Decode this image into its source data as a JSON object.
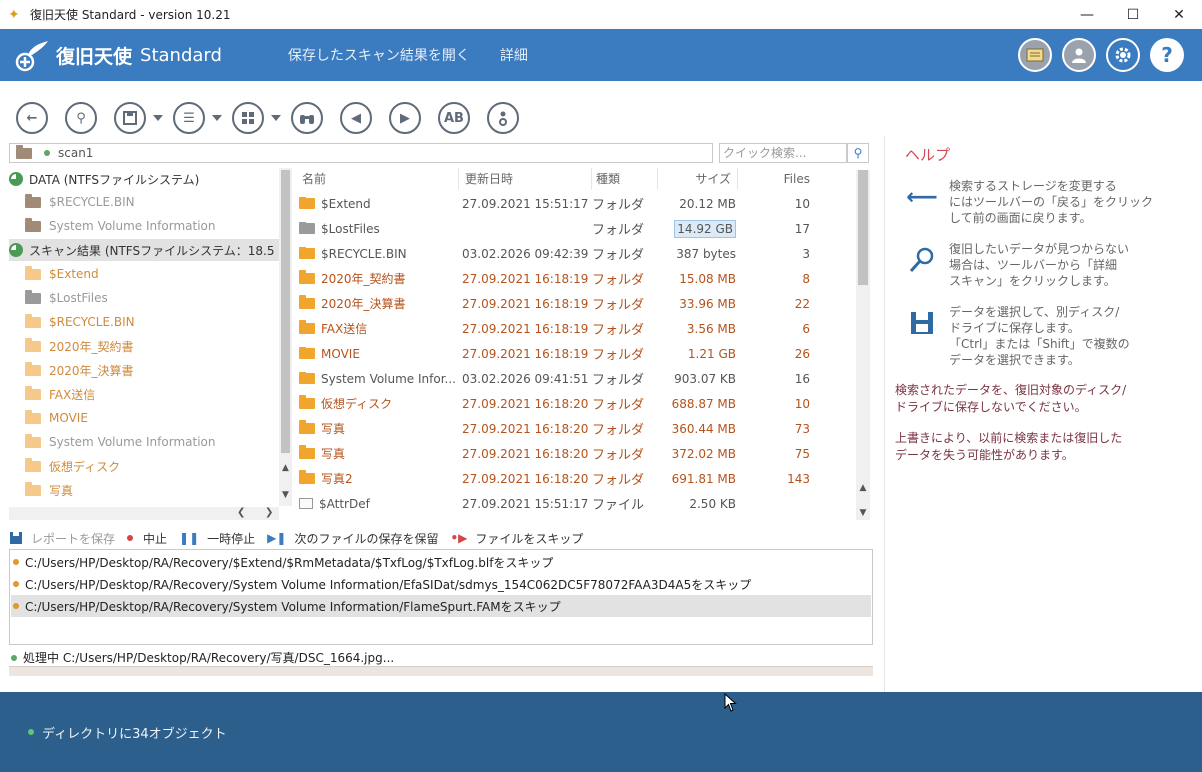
{
  "window": {
    "title": "復旧天使 Standard - version 10.21",
    "controls": [
      "minimize",
      "maximize",
      "close"
    ]
  },
  "header": {
    "brand": "復旧天使",
    "brand_sub": "Standard",
    "links": [
      "保存したスキャン結果を開く",
      "詳細"
    ],
    "icons": [
      "news-icon",
      "user-icon",
      "settings-icon",
      "help-icon"
    ]
  },
  "toolbar": {
    "buttons": [
      "back-icon",
      "search-icon",
      "save-icon",
      "list-icon",
      "view-icon",
      "find-icon",
      "prev-icon",
      "next-icon",
      "case-icon",
      "info-icon"
    ],
    "case_label": "AB"
  },
  "pathbar": {
    "text": "scan1"
  },
  "search": {
    "placeholder": "クイック検索..."
  },
  "tree": {
    "root1": "DATA (NTFSファイルシステム)",
    "root1_items": [
      "$RECYCLE.BIN",
      "System Volume Information"
    ],
    "root2": "スキャン結果 (NTFSファイルシステム：18.5",
    "root2_items": [
      "$Extend",
      "$LostFiles",
      "$RECYCLE.BIN",
      "2020年_契約書",
      "2020年_決算書",
      "FAX送信",
      "MOVIE",
      "System Volume Information",
      "仮想ディスク",
      "写真"
    ]
  },
  "list": {
    "headers": {
      "name": "名前",
      "date": "更新日時",
      "kind": "種類",
      "size": "サイズ",
      "files": "Files"
    },
    "rows": [
      {
        "name": "$Extend",
        "date": "27.09.2021 15:51:17",
        "kind": "フォルダ",
        "size": "20.12 MB",
        "files": "10"
      },
      {
        "name": "$LostFiles",
        "date": "",
        "kind": "フォルダ",
        "size": "14.92 GB",
        "files": "17"
      },
      {
        "name": "$RECYCLE.BIN",
        "date": "03.02.2026 09:42:39",
        "kind": "フォルダ",
        "size": "387 bytes",
        "files": "3"
      },
      {
        "name": "2020年_契約書",
        "date": "27.09.2021 16:18:19",
        "kind": "フォルダ",
        "size": "15.08 MB",
        "files": "8"
      },
      {
        "name": "2020年_決算書",
        "date": "27.09.2021 16:18:19",
        "kind": "フォルダ",
        "size": "33.96 MB",
        "files": "22"
      },
      {
        "name": "FAX送信",
        "date": "27.09.2021 16:18:19",
        "kind": "フォルダ",
        "size": "3.56 MB",
        "files": "6"
      },
      {
        "name": "MOVIE",
        "date": "27.09.2021 16:18:19",
        "kind": "フォルダ",
        "size": "1.21 GB",
        "files": "26"
      },
      {
        "name": "System Volume Infor...",
        "date": "03.02.2026 09:41:51",
        "kind": "フォルダ",
        "size": "903.07 KB",
        "files": "16"
      },
      {
        "name": "仮想ディスク",
        "date": "27.09.2021 16:18:20",
        "kind": "フォルダ",
        "size": "688.87 MB",
        "files": "10"
      },
      {
        "name": "写真",
        "date": "27.09.2021 16:18:20",
        "kind": "フォルダ",
        "size": "360.44 MB",
        "files": "73"
      },
      {
        "name": "写真",
        "date": "27.09.2021 16:18:20",
        "kind": "フォルダ",
        "size": "372.02 MB",
        "files": "75"
      },
      {
        "name": "写真2",
        "date": "27.09.2021 16:18:20",
        "kind": "フォルダ",
        "size": "691.81 MB",
        "files": "143"
      },
      {
        "name": "$AttrDef",
        "date": "27.09.2021 15:51:17",
        "kind": "ファイル",
        "size": "2.50 KB",
        "files": ""
      }
    ]
  },
  "logbar": {
    "save_report": "レポートを保存",
    "stop": "中止",
    "pause": "一時停止",
    "keep_next": "次のファイルの保存を保留",
    "skip": "ファイルをスキップ"
  },
  "log": [
    "C:/Users/HP/Desktop/RA/Recovery/$Extend/$RmMetadata/$TxfLog/$TxfLog.blfをスキップ",
    "C:/Users/HP/Desktop/RA/Recovery/System Volume Information/EfaSIDat/sdmys_154C062DC5F78072FAA3D4A5をスキップ",
    "C:/Users/HP/Desktop/RA/Recovery/System Volume Information/FlameSpurt.FAMをスキップ"
  ],
  "status": {
    "text": "処理中 C:/Users/HP/Desktop/RA/Recovery/写真/DSC_1664.jpg..."
  },
  "help": {
    "title": "ヘルプ",
    "items": [
      "検索するストレージを変更する\nにはツールバーの「戻る」をクリック\nして前の画面に戻ります。",
      "復旧したいデータが見つからない\n場合は、ツールバーから「詳細\nスキャン」をクリックします。",
      "データを選択して、別ディスク/\nドライブに保存します。\n「Ctrl」または「Shift」で複数の\nデータを選択できます。"
    ],
    "note1": "検索されたデータを、復旧対象のディスク/\nドライブに保存しないでください。",
    "note2": "上書きにより、以前に検索または復旧した\nデータを失う可能性があります。"
  },
  "footer": {
    "text": "ディレクトリに34オブジェクト"
  }
}
